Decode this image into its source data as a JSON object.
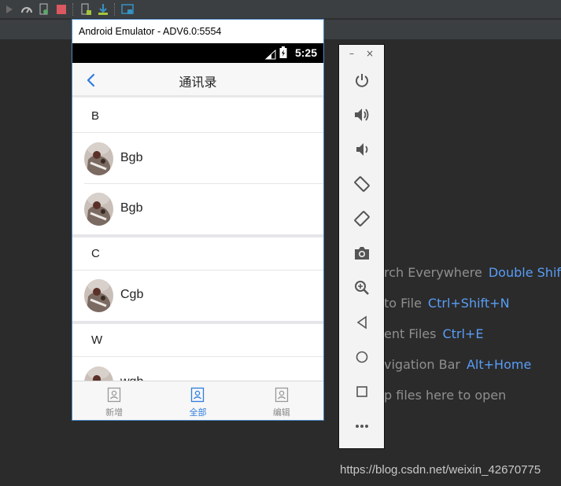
{
  "emulator": {
    "window_title": "Android Emulator - ADV6.0:5554",
    "status_time": "5:25",
    "app_title": "通讯录",
    "sections": [
      {
        "letter": "B",
        "contacts": [
          {
            "name": "Bgb"
          },
          {
            "name": "Bgb"
          }
        ]
      },
      {
        "letter": "C",
        "contacts": [
          {
            "name": "Cgb"
          }
        ]
      },
      {
        "letter": "W",
        "contacts": [
          {
            "name": "wgb"
          }
        ]
      }
    ],
    "bottom_nav": [
      {
        "label": "新增",
        "active": false
      },
      {
        "label": "全部",
        "active": true
      },
      {
        "label": "编辑",
        "active": false
      }
    ]
  },
  "side_toolbar": {
    "minimize": "–",
    "close": "×",
    "buttons": [
      "power-icon",
      "volume-up-icon",
      "volume-down-icon",
      "rotate-left-icon",
      "rotate-right-icon",
      "camera-icon",
      "zoom-icon",
      "back-icon",
      "home-icon",
      "overview-icon",
      "more-icon"
    ]
  },
  "ide_hints": [
    {
      "label": "rch Everywhere",
      "key": "Double Shift"
    },
    {
      "label": "to File",
      "key": "Ctrl+Shift+N"
    },
    {
      "label": "ent Files",
      "key": "Ctrl+E"
    },
    {
      "label": "vigation Bar",
      "key": "Alt+Home"
    },
    {
      "label": "p files here to open",
      "key": ""
    }
  ],
  "watermark": "https://blog.csdn.net/weixin_42670775",
  "colors": {
    "accent": "#2d7de0",
    "ide_bg": "#2b2b2b",
    "hint_key": "#589df6"
  }
}
